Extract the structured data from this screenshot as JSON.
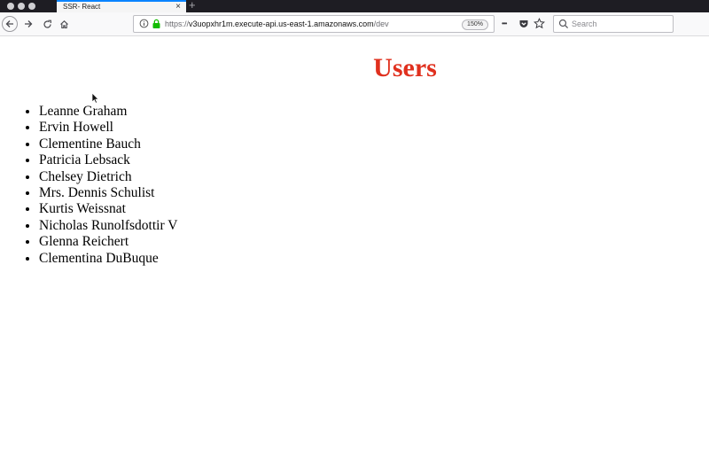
{
  "browser": {
    "tab_title": "SSR- React",
    "tab_close": "×",
    "new_tab": "+",
    "url_scheme": "https://",
    "url_host": "v3uopxhr1m.execute-api.us-east-1.amazonaws.com",
    "url_path": "/dev",
    "zoom": "150%",
    "more_label": "•••",
    "search_placeholder": "Search"
  },
  "page": {
    "title": "Users",
    "title_color": "#e0301e",
    "users": [
      "Leanne Graham",
      "Ervin Howell",
      "Clementine Bauch",
      "Patricia Lebsack",
      "Chelsey Dietrich",
      "Mrs. Dennis Schulist",
      "Kurtis Weissnat",
      "Nicholas Runolfsdottir V",
      "Glenna Reichert",
      "Clementina DuBuque"
    ]
  }
}
